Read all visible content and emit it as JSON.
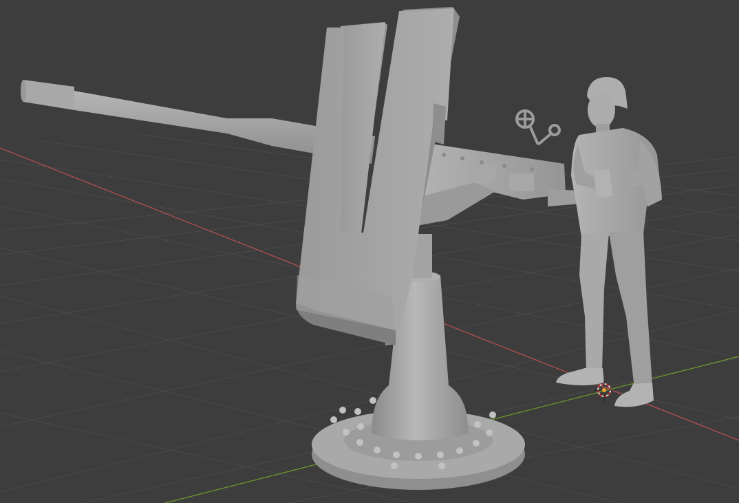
{
  "viewport": {
    "background": "#3d3d3d",
    "grid_color": "#4a4a4a",
    "x_axis_color": "#c05050",
    "y_axis_color": "#6fa02a",
    "model_color": "#a5a5a5"
  },
  "scene": {
    "objects": [
      "anti-aircraft-gun",
      "soldier-figure"
    ],
    "cursor_icon": "3d-cursor-icon"
  }
}
